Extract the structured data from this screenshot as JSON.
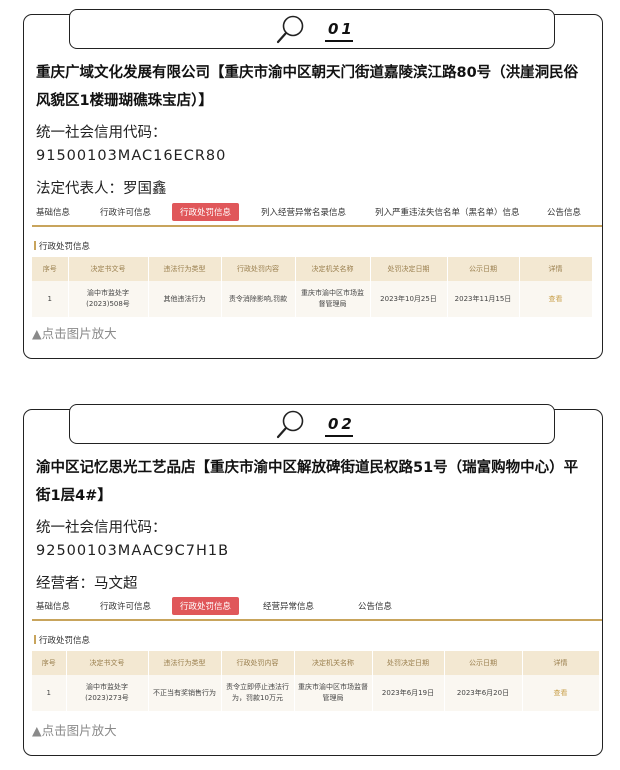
{
  "cards": [
    {
      "number": "01",
      "company": "重庆广域文化发展有限公司【重庆市渝中区朝天门街道嘉陵滨江路80号（洪崖洞民俗风貌区1楼珊瑚礁珠宝店）】",
      "credit_label": "统一社会信用代码：",
      "credit_code": "91500103MAC16ECR80",
      "rep_label": "法定代表人：罗国鑫",
      "tabs": [
        "基础信息",
        "行政许可信息",
        "行政处罚信息",
        "列入经营异常名录信息",
        "列入严重违法失信名单（黑名单）信息",
        "公告信息"
      ],
      "section_title": "行政处罚信息",
      "table_headers": [
        "序号",
        "决定书文号",
        "违法行为类型",
        "行政处罚内容",
        "决定机关名称",
        "处罚决定日期",
        "公示日期",
        "详情"
      ],
      "row": [
        "1",
        "渝中市监处字(2023)508号",
        "其他违法行为",
        "责令消除影响,罚款",
        "重庆市渝中区市场监督管理局",
        "2023年10月25日",
        "2023年11月15日",
        "查看"
      ],
      "enlarge": "▲点击图片放大"
    },
    {
      "number": "02",
      "company": "渝中区记忆思光工艺品店【重庆市渝中区解放碑街道民权路51号（瑞富购物中心）平街1层4#】",
      "credit_label": "统一社会信用代码：",
      "credit_code": "92500103MAAC9C7H1B",
      "rep_label": "经营者：马文超",
      "tabs": [
        "基础信息",
        "行政许可信息",
        "行政处罚信息",
        "经营异常信息",
        "公告信息"
      ],
      "section_title": "行政处罚信息",
      "table_headers": [
        "序号",
        "决定书文号",
        "违法行为类型",
        "行政处罚内容",
        "决定机关名称",
        "处罚决定日期",
        "公示日期",
        "详情"
      ],
      "row": [
        "1",
        "渝中市监处字(2023)273号",
        "不正当有奖销售行为",
        "责令立即停止违法行为，罚款10万元",
        "重庆市渝中区市场监督管理局",
        "2023年6月19日",
        "2023年6月20日",
        "查看"
      ],
      "enlarge": "▲点击图片放大"
    }
  ],
  "colors": {
    "active_tab": "#e0575a",
    "accent": "#c8a45c",
    "table_header_bg": "#f3e8d2"
  },
  "icons": {
    "header": "magnifier-icon"
  }
}
